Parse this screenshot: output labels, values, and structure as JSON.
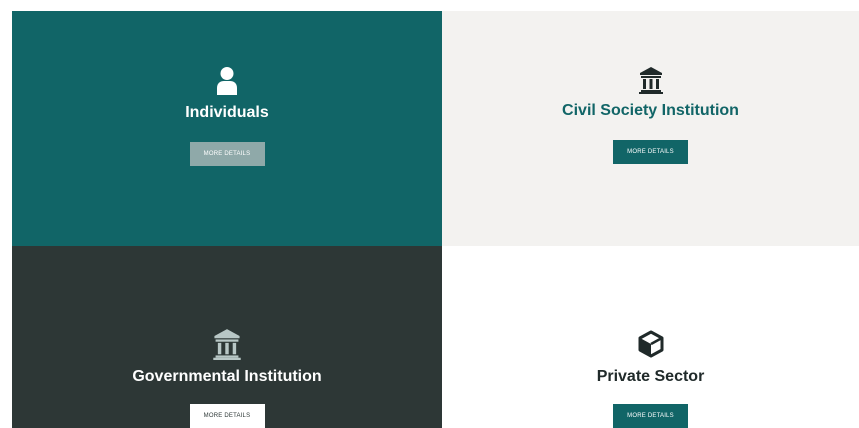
{
  "categories": [
    {
      "title": "Individuals",
      "button_label": "MORE DETAILS",
      "icon": "user-icon"
    },
    {
      "title": "Civil Society Institution",
      "button_label": "MORE DETAILS",
      "icon": "institution-icon"
    },
    {
      "title": "Governmental Institution",
      "button_label": "MORE DETAILS",
      "icon": "institution-icon"
    },
    {
      "title": "Private Sector",
      "button_label": "MORE DETAILS",
      "icon": "cube-icon"
    }
  ],
  "colors": {
    "teal": "#116567",
    "light_gray": "#f3f2f0",
    "dark_slate": "#2d3736",
    "white": "#ffffff",
    "muted_teal_button": "#8fa9a9"
  }
}
